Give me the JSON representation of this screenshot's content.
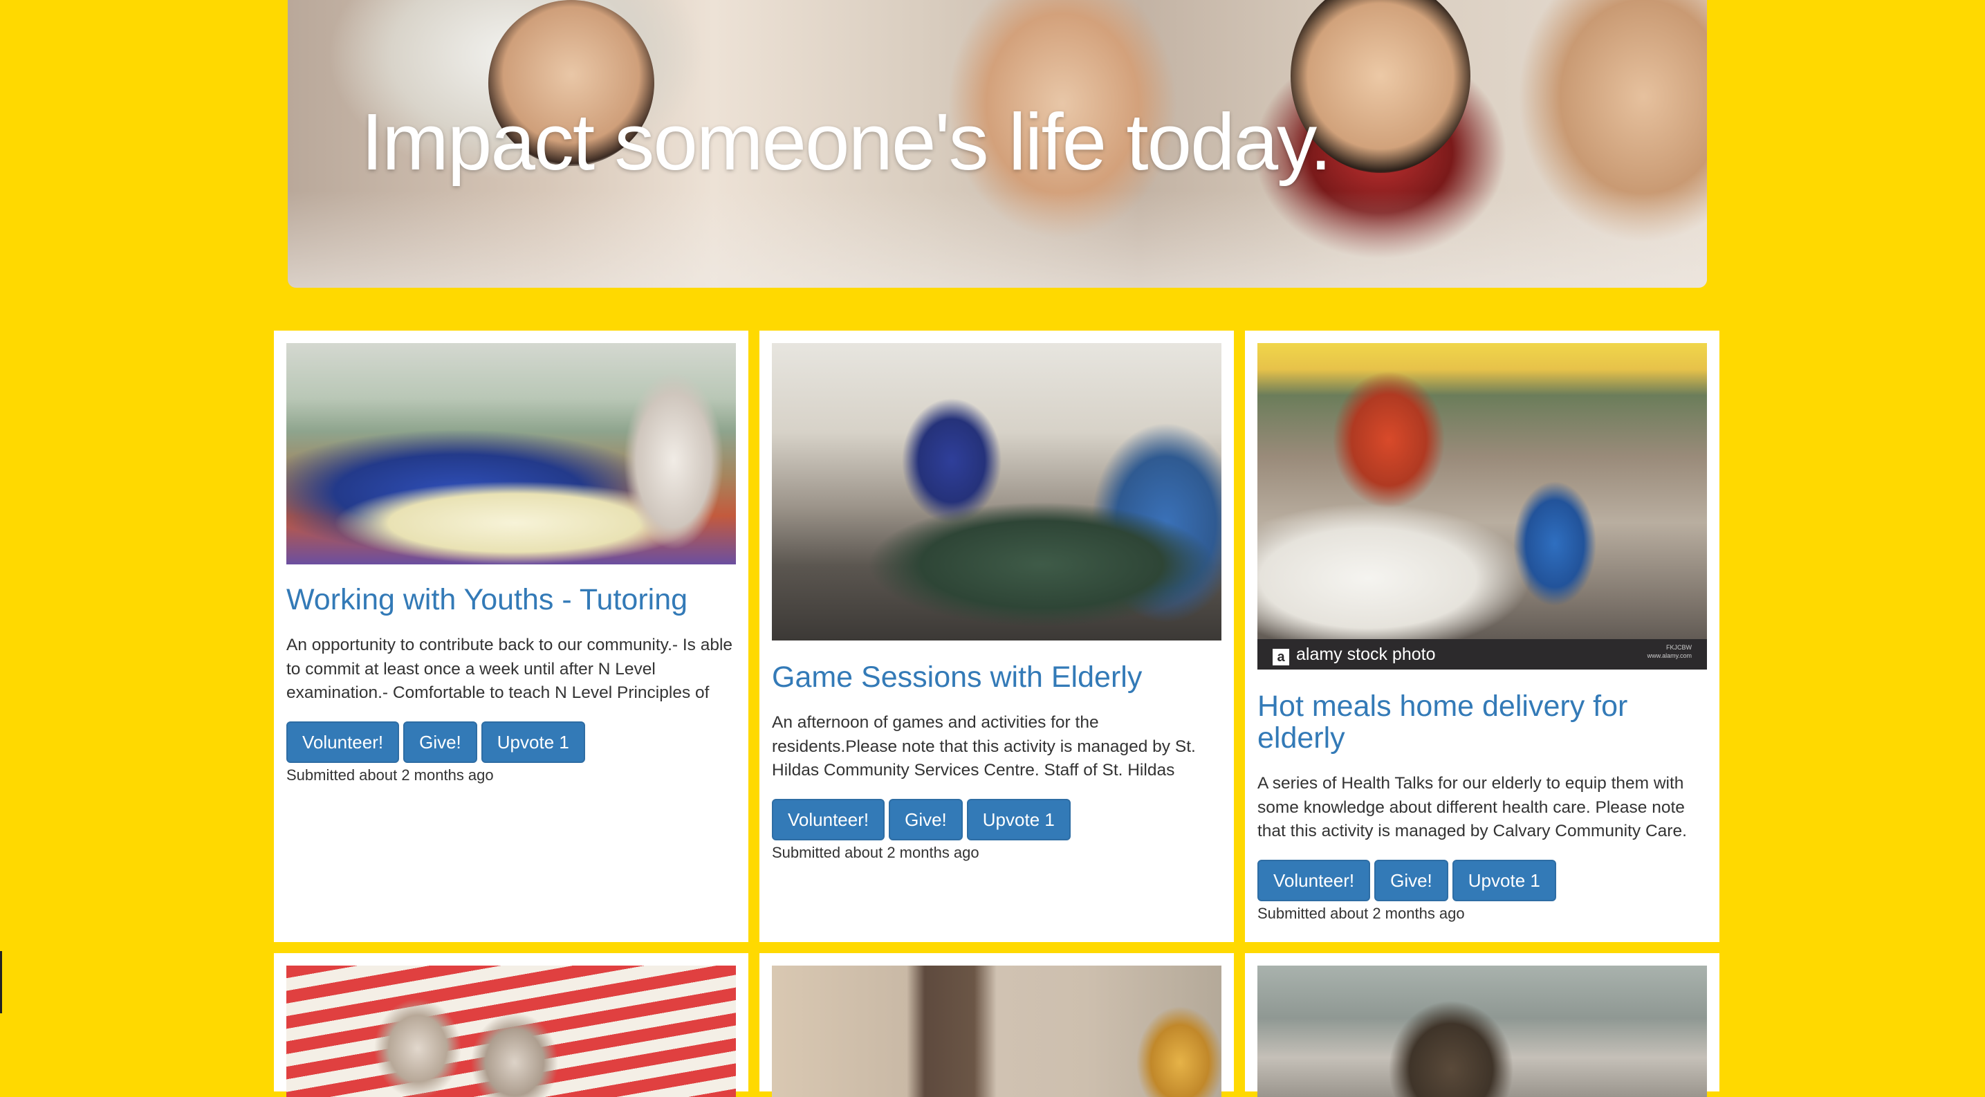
{
  "hero": {
    "title": "Impact someone's life today."
  },
  "cards": [
    {
      "title": "Working with Youths - Tutoring",
      "description": "An opportunity to contribute back to our community.- Is able to commit at least once a week until after N Level examination.- Comfortable to teach N Level Principles of",
      "buttons": {
        "volunteer": "Volunteer!",
        "give": "Give!",
        "upvote": "Upvote 1"
      },
      "submitted": "Submitted about 2 months ago"
    },
    {
      "title": "Game Sessions with Elderly",
      "description": "An afternoon of games and activities for the residents.Please note that this activity is managed by St. Hildas Community Services Centre. Staff of St. Hildas",
      "buttons": {
        "volunteer": "Volunteer!",
        "give": "Give!",
        "upvote": "Upvote 1"
      },
      "submitted": "Submitted about 2 months ago"
    },
    {
      "title": "Hot meals home delivery for elderly",
      "description": "A series of Health Talks for our elderly to equip them with some knowledge about different health care. Please note that this activity is managed by Calvary Community Care.",
      "buttons": {
        "volunteer": "Volunteer!",
        "give": "Give!",
        "upvote": "Upvote 1"
      },
      "submitted": "Submitted about 2 months ago",
      "watermark": {
        "label": "alamy stock photo",
        "logo_letter": "a",
        "code_line1": "FKJCBW",
        "code_line2": "www.alamy.com"
      }
    }
  ],
  "colors": {
    "page_background": "#FFD900",
    "primary": "#337AB7",
    "title_link": "#337AB7",
    "text": "#333333"
  }
}
